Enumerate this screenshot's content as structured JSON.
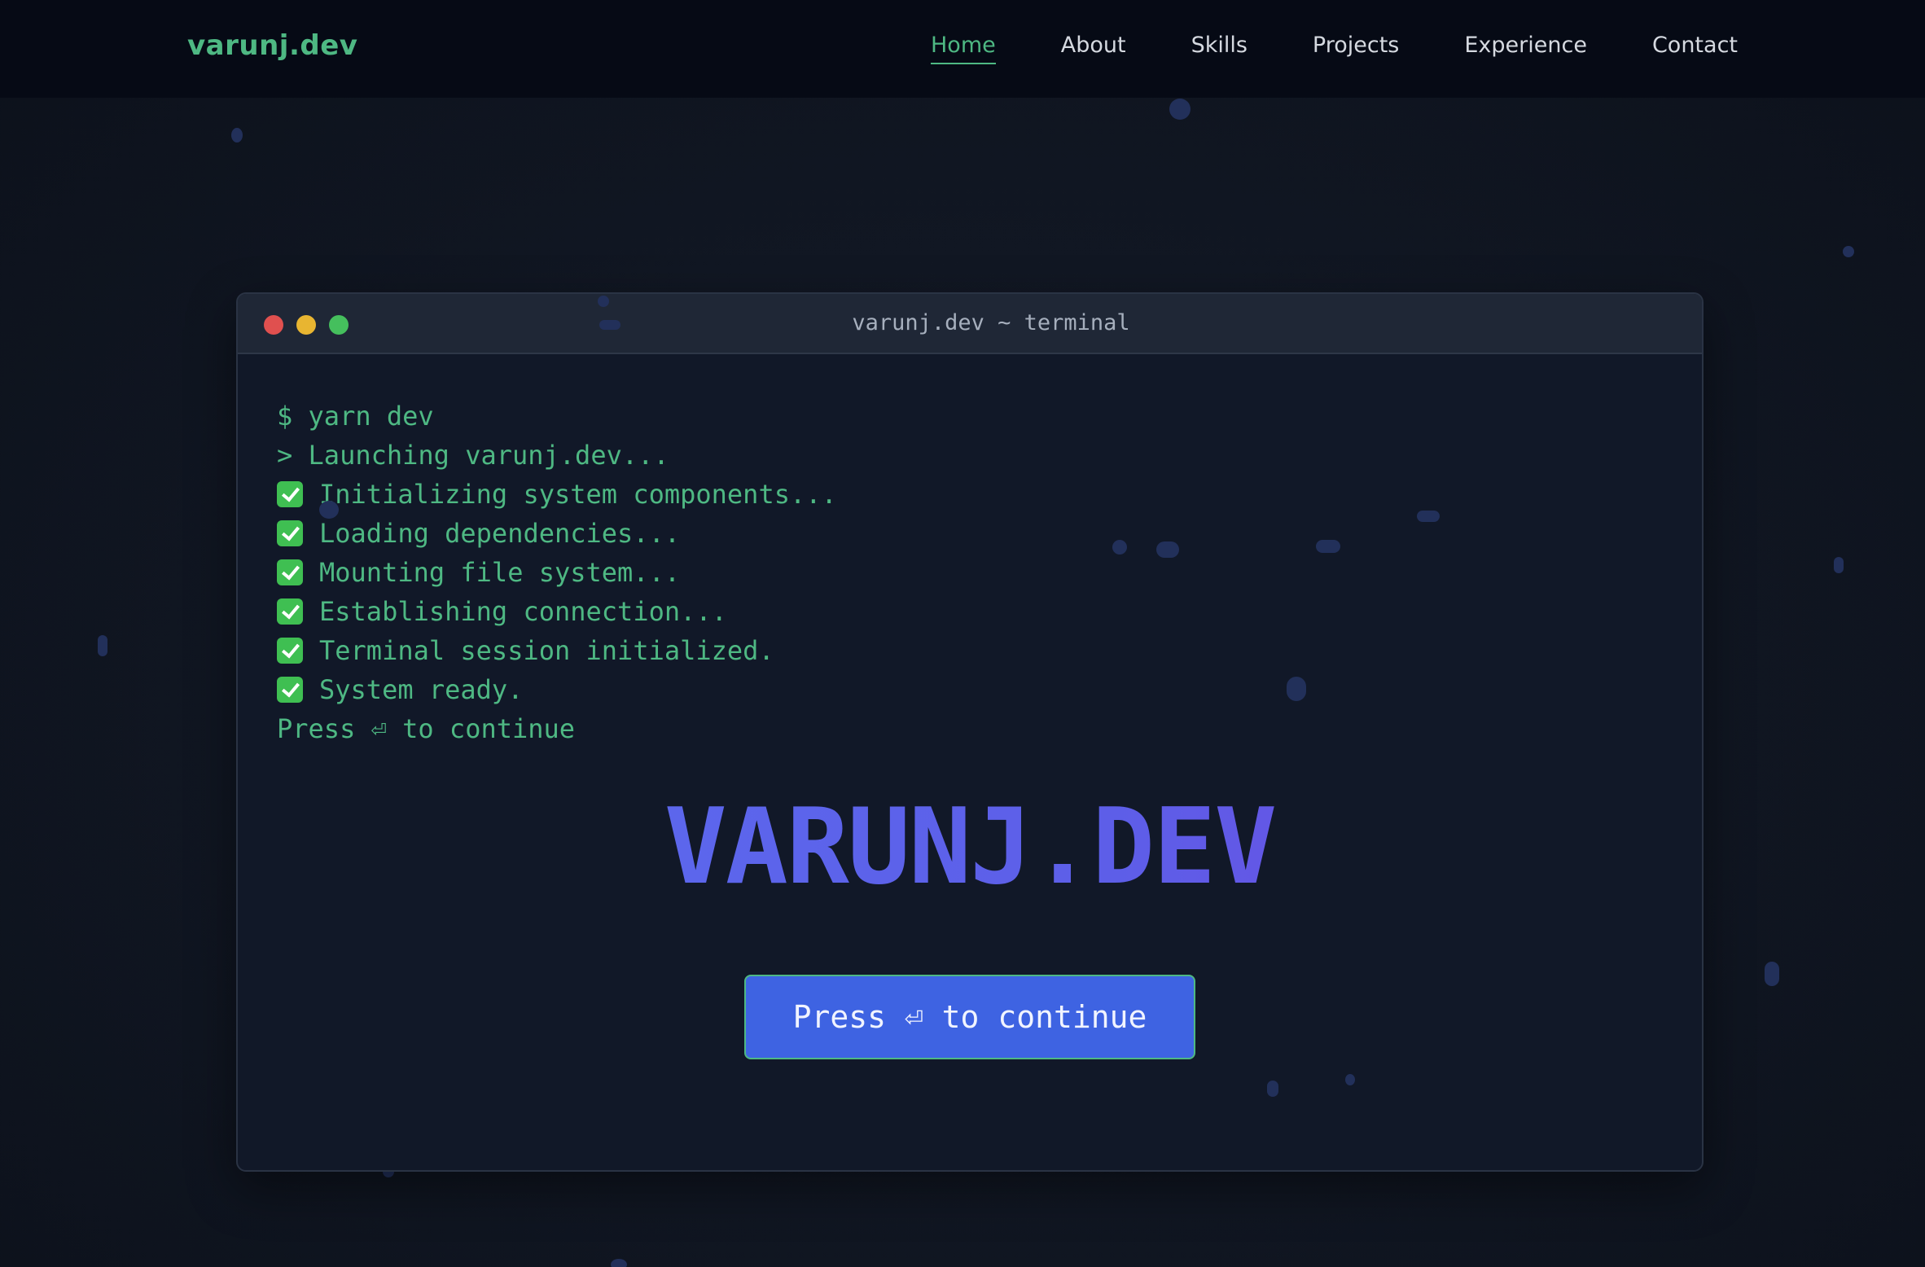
{
  "nav": {
    "brand": "varunj.dev",
    "links": [
      "Home",
      "About",
      "Skills",
      "Projects",
      "Experience",
      "Contact"
    ],
    "active": "Home"
  },
  "terminal": {
    "title": "varunj.dev ~ terminal",
    "window_buttons": [
      "close-icon",
      "minimize-icon",
      "maximize-icon"
    ],
    "window_button_colors": [
      "#e0504f",
      "#e8b531",
      "#45bf5d"
    ],
    "lines": [
      {
        "icon": "",
        "text": "$ yarn dev"
      },
      {
        "icon": "",
        "text": "> Launching varunj.dev..."
      },
      {
        "icon": "check-icon",
        "text": "Initializing system components..."
      },
      {
        "icon": "check-icon",
        "text": "Loading dependencies..."
      },
      {
        "icon": "check-icon",
        "text": "Mounting file system..."
      },
      {
        "icon": "check-icon",
        "text": "Establishing connection..."
      },
      {
        "icon": "check-icon",
        "text": "Terminal session initialized."
      },
      {
        "icon": "check-icon",
        "text": "System ready."
      },
      {
        "icon": "",
        "text": "Press ⏎ to continue"
      }
    ],
    "headline": "VARUNJ.DEV",
    "continue_button": "Press ⏎ to continue"
  },
  "colors": {
    "accent_green": "#4eb883",
    "button_blue": "#3e63e2",
    "headline_gradient": [
      "#5b6ef0",
      "#7246e0"
    ]
  }
}
